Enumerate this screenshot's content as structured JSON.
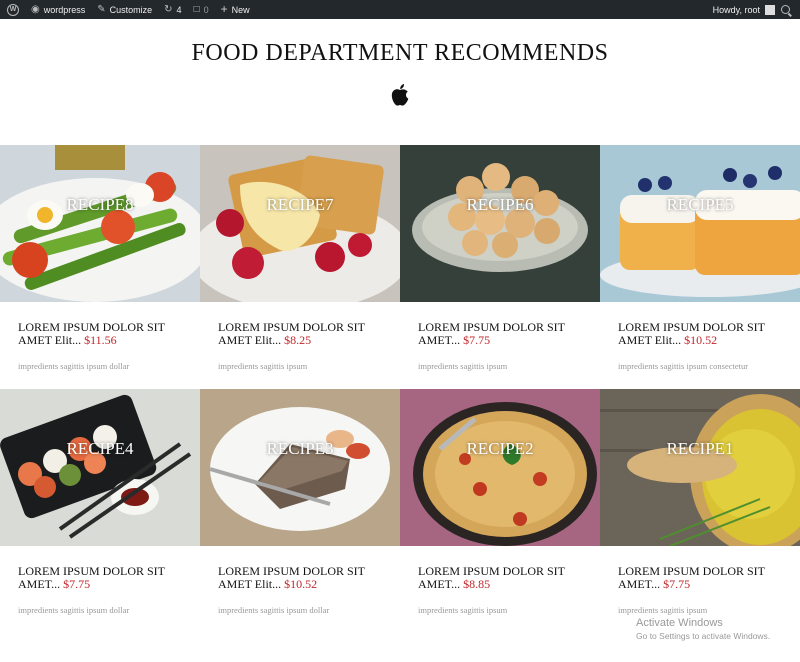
{
  "adminbar": {
    "site_name": "wordpress",
    "customize_label": "Customize",
    "updates_count": "4",
    "comments_count": "0",
    "new_label": "New",
    "greeting": "Howdy, root"
  },
  "header": {
    "title": "FOOD DEPARTMENT RECOMMENDS"
  },
  "recipes": [
    {
      "label": "RECIPE8",
      "title": "LOREM IPSUM DOLOR SIT AMET Elit...",
      "price": "$11.56",
      "ingredients": "impredients sagittis ipsum dollar"
    },
    {
      "label": "RECIPE7",
      "title": "LOREM IPSUM DOLOR SIT AMET Elit...",
      "price": "$8.25",
      "ingredients": "impredients sagittis ipsum"
    },
    {
      "label": "RECIPE6",
      "title": "LOREM IPSUM DOLOR SIT AMET...",
      "price": "$7.75",
      "ingredients": "impredients sagittis ipsum"
    },
    {
      "label": "RECIPE5",
      "title": "LOREM IPSUM DOLOR SIT AMET Elit...",
      "price": "$10.52",
      "ingredients": "impredients sagittis ipsum consectetur"
    },
    {
      "label": "RECIPE4",
      "title": "LOREM IPSUM DOLOR SIT AMET...",
      "price": "$7.75",
      "ingredients": "impredients sagittis ipsum dollar"
    },
    {
      "label": "RECIPE3",
      "title": "LOREM IPSUM DOLOR SIT AMET Elit...",
      "price": "$10.52",
      "ingredients": "impredients sagittis ipsum dollar"
    },
    {
      "label": "RECIPE2",
      "title": "LOREM IPSUM DOLOR SIT AMET...",
      "price": "$8.85",
      "ingredients": "impredients sagittis ipsum"
    },
    {
      "label": "RECIPE1",
      "title": "LOREM IPSUM DOLOR SIT AMET...",
      "price": "$7.75",
      "ingredients": "impredients sagittis ipsum"
    }
  ],
  "watermark": {
    "line1": "Activate Windows",
    "line2": "Go to Settings to activate Windows."
  },
  "colors": {
    "adminbar_bg": "#23282d",
    "price": "#c0262b"
  }
}
